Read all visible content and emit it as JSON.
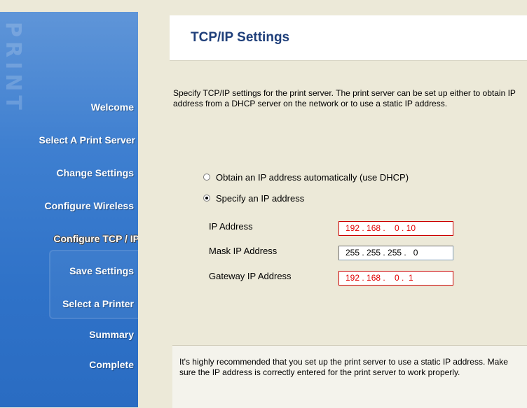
{
  "sidebar": {
    "deco_text": "PRINT",
    "items": [
      {
        "label": "Welcome"
      },
      {
        "label": "Select A Print Server"
      },
      {
        "label": "Change Settings"
      },
      {
        "label": "Configure Wireless"
      },
      {
        "label": "Configure TCP / IP"
      },
      {
        "label": "Save Settings"
      },
      {
        "label": "Select a Printer"
      },
      {
        "label": "Summary"
      },
      {
        "label": "Complete"
      }
    ],
    "active_index": 4
  },
  "header": {
    "title": "TCP/IP Settings"
  },
  "description": "Specify TCP/IP settings for the print server. The print server can be set up either to obtain IP address from a DHCP server on the network or to use a static IP address.",
  "options": {
    "dhcp": {
      "label": "Obtain an IP address automatically (use DHCP)",
      "selected": false
    },
    "static": {
      "label": "Specify an IP address",
      "selected": true
    }
  },
  "fields": {
    "ip_address": {
      "label": "IP Address",
      "value": "192 . 168 .    0 . 10"
    },
    "mask": {
      "label": "Mask IP Address",
      "value": "255 . 255 . 255 .   0"
    },
    "gateway": {
      "label": "Gateway IP Address",
      "value": "192 . 168 .    0 .  1"
    }
  },
  "note": "It's highly recommended that you set up the print server to use a static IP address. Make sure the IP address is correctly entered for the print server to work properly.",
  "colors": {
    "sidebar_blue": "#3e7fd0",
    "title": "#1f3f7a",
    "ip_red": "#e00000"
  }
}
